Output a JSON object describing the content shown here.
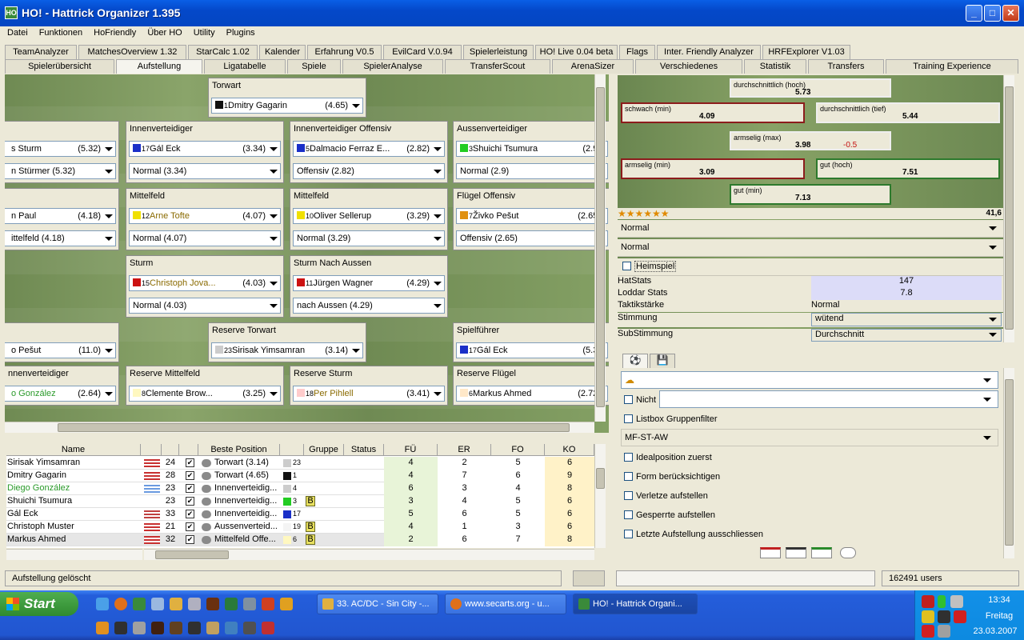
{
  "window": {
    "title": "HO! - Hattrick Organizer 1.395",
    "app_icon": "HO"
  },
  "menu": [
    "Datei",
    "Funktionen",
    "HoFriendly",
    "Über HO",
    "Utility",
    "Plugins"
  ],
  "plugin_tabs": [
    "TeamAnalyzer",
    "MatchesOverview 1.32",
    "StarCalc 1.02",
    "Kalender",
    "Erfahrung V0.5",
    "EvilCard V.0.94",
    "Spielerleistung",
    "HO! Live 0.04 beta",
    "Flags",
    "Inter. Friendly Analyzer",
    "HRFExplorer V1.03"
  ],
  "main_tabs": [
    "Spielerübersicht",
    "Aufstellung",
    "Ligatabelle",
    "Spiele",
    "SpielerAnalyse",
    "TransferScout",
    "ArenaSizer",
    "Verschiedenes",
    "Statistik",
    "Transfers",
    "Training Experience"
  ],
  "positions": {
    "torwart": {
      "label": "Torwart",
      "num": "1",
      "player": "Dmitry Gagarin",
      "rating": "(4.65)",
      "shirt": "#111111"
    },
    "left1": {
      "player": "s Sturm",
      "rating": "(5.32)",
      "order": "n Stürmer (5.32)",
      "shirt": "#ffffff"
    },
    "iv": {
      "label": "Innenverteidiger",
      "num": "17",
      "player": "Gál Eck",
      "rating": "(3.34)",
      "order": "Normal (3.34)",
      "shirt": "#1a2fc8"
    },
    "ivo": {
      "label": "Innenverteidiger Offensiv",
      "num": "5",
      "player": "Dalmacio Ferraz E...",
      "rating": "(2.82)",
      "order": "Offensiv (2.82)",
      "shirt": "#1a2fc8"
    },
    "av": {
      "label": "Aussenverteidiger",
      "num": "3",
      "player": "Shuichi Tsumura",
      "rating": "(2.9)",
      "order": "Normal (2.9)",
      "shirt": "#22cc22"
    },
    "left2": {
      "player": "n Paul",
      "rating": "(4.18)",
      "order": "ittelfeld (4.18)"
    },
    "mf1": {
      "label": "Mittelfeld",
      "num": "12",
      "player": "Arne Tofte",
      "rating": "(4.07)",
      "order": "Normal (4.07)",
      "shirt": "#f0e000"
    },
    "mf2": {
      "label": "Mittelfeld",
      "num": "10",
      "player": "Oliver Sellerup",
      "rating": "(3.29)",
      "order": "Normal (3.29)",
      "shirt": "#f0e000"
    },
    "fo": {
      "label": "Flügel Offensiv",
      "num": "7",
      "player": "Živko Pešut",
      "rating": "(2.65)",
      "order": "Offensiv (2.65)",
      "shirt": "#e09010"
    },
    "st": {
      "label": "Sturm",
      "num": "15",
      "player": "Christoph Jova...",
      "rating": "(4.03)",
      "order": "Normal (4.03)",
      "shirt": "#cc1111"
    },
    "sna": {
      "label": "Sturm Nach Aussen",
      "num": "11",
      "player": "Jürgen Wagner",
      "rating": "(4.29)",
      "order": "nach Aussen (4.29)",
      "shirt": "#cc1111"
    },
    "left3": {
      "player": "o Pešut",
      "rating": "(11.0)"
    },
    "rtw": {
      "label": "Reserve Torwart",
      "num": "23",
      "player": "Sirisak Yimsamran",
      "rating": "(3.14)",
      "shirt": "#cccccc"
    },
    "kapitaen": {
      "label": "Spielführer",
      "num": "17",
      "player": "Gál Eck",
      "rating": "(5.3)",
      "shirt": "#1a2fc8"
    },
    "left4": {
      "label": "nnenverteidiger",
      "player": "o González",
      "rating": "(2.64)"
    },
    "rmf": {
      "label": "Reserve Mittelfeld",
      "num": "8",
      "player": "Clemente Brow...",
      "rating": "(3.25)",
      "shirt": "#fff8c0"
    },
    "rst": {
      "label": "Reserve Sturm",
      "num": "18",
      "player": "Per Pihlell",
      "rating": "(3.41)",
      "shirt": "#ffcccc"
    },
    "rfl": {
      "label": "Reserve Flügel",
      "num": "6",
      "player": "Markus Ahmed",
      "rating": "(2.72)",
      "shirt": "#ffe8c8"
    }
  },
  "ratings": {
    "top": {
      "t": "durchschnittlich (hoch)",
      "v": "5.73"
    },
    "left": {
      "t": "schwach (min)",
      "v": "4.09"
    },
    "right": {
      "t": "durchschnittlich (tief)",
      "v": "5.44"
    },
    "mid": {
      "t": "armselig (max)",
      "v": "3.98",
      "delta": "-0.5"
    },
    "dleft": {
      "t": "armselig (min)",
      "v": "3.09"
    },
    "dright": {
      "t": "gut (hoch)",
      "v": "7.51"
    },
    "bottom": {
      "t": "gut (min)",
      "v": "7.13"
    },
    "stars": "★★★★★★",
    "total": "41,6",
    "dropdown1": "Normal",
    "dropdown2": "Normal",
    "heimspiel": "Heimspiel",
    "stats": [
      {
        "k": "HatStats",
        "v": "147"
      },
      {
        "k": "Loddar Stats",
        "v": "7.8"
      },
      {
        "k": "Taktikstärke",
        "v": "Normal"
      },
      {
        "k": "Stimmung",
        "v": "wütend"
      },
      {
        "k": "SubStimmung",
        "v": "Durchschnitt"
      }
    ]
  },
  "assistant": {
    "nicht": "Nicht",
    "listbox": "Listbox Gruppenfilter",
    "formation": "MF-ST-AW",
    "options": [
      "Idealposition zuerst",
      "Form berücksichtigen",
      "Verletze aufstellen",
      "Gesperrte aufstellen",
      "Letzte Aufstellung ausschliessen"
    ]
  },
  "table": {
    "headers": [
      "Name",
      "",
      "",
      "",
      "Beste Position",
      "",
      "Gruppe",
      "Status",
      "FÜ",
      "ER",
      "FO",
      "KO"
    ],
    "rows": [
      {
        "name": "Sirisak Yimsamran",
        "age": "24",
        "pos": "Torwart (3.14)",
        "num": "23",
        "fu": "4",
        "er": "2",
        "fo": "5",
        "ko": "6"
      },
      {
        "name": "Dmitry Gagarin",
        "age": "28",
        "pos": "Torwart (4.65)",
        "num": "1",
        "fu": "4",
        "er": "7",
        "fo": "6",
        "ko": "9"
      },
      {
        "name": "Diego González",
        "age": "23",
        "pos": "Innenverteidig...",
        "num": "4",
        "fu": "6",
        "er": "3",
        "fo": "4",
        "ko": "8"
      },
      {
        "name": "Shuichi Tsumura",
        "age": "23",
        "pos": "Innenverteidig...",
        "num": "3",
        "grp": "B",
        "fu": "3",
        "er": "4",
        "fo": "5",
        "ko": "6"
      },
      {
        "name": "Gál Eck",
        "age": "33",
        "pos": "Innenverteidig...",
        "num": "17",
        "fu": "5",
        "er": "6",
        "fo": "5",
        "ko": "6"
      },
      {
        "name": "Christoph Muster",
        "age": "21",
        "pos": "Aussenverteid...",
        "num": "19",
        "grp": "B",
        "fu": "4",
        "er": "1",
        "fo": "3",
        "ko": "6"
      },
      {
        "name": "Markus Ahmed",
        "age": "32",
        "pos": "Mittelfeld Offe...",
        "num": "6",
        "grp": "B",
        "fu": "2",
        "er": "6",
        "fo": "7",
        "ko": "8"
      }
    ]
  },
  "status": {
    "message": "Aufstellung gelöscht",
    "users": "162491 users"
  },
  "taskbar": {
    "start": "Start",
    "items": [
      "33. AC/DC - Sin City -...",
      "www.secarts.org - u...",
      "HO! - Hattrick Organi..."
    ],
    "time": "13:34",
    "day": "Freitag",
    "date": "23.03.2007"
  },
  "colors": {
    "accent": "#0a5fe6",
    "field": "#7a9660",
    "panel": "#ece9d8"
  }
}
